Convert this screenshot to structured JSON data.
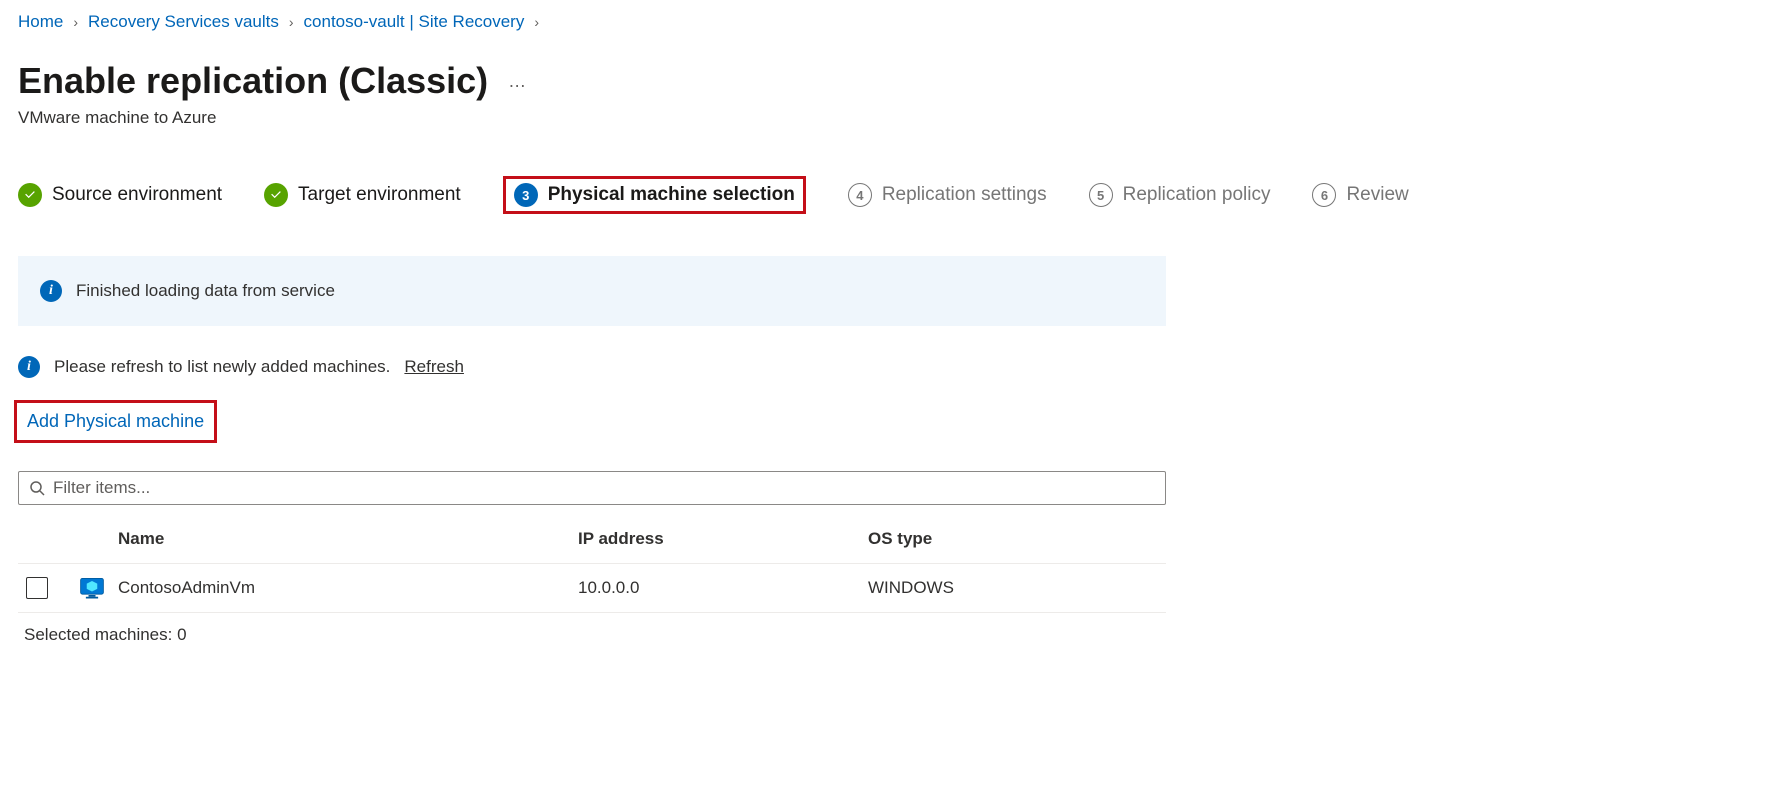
{
  "breadcrumb": [
    {
      "label": "Home"
    },
    {
      "label": "Recovery Services vaults"
    },
    {
      "label": "contoso-vault | Site Recovery"
    }
  ],
  "page": {
    "title": "Enable replication (Classic)",
    "subtitle": "VMware machine to Azure"
  },
  "steps": [
    {
      "label": "Source environment",
      "state": "done",
      "num": "1"
    },
    {
      "label": "Target environment",
      "state": "done",
      "num": "2"
    },
    {
      "label": "Physical machine selection",
      "state": "current",
      "num": "3"
    },
    {
      "label": "Replication settings",
      "state": "future",
      "num": "4"
    },
    {
      "label": "Replication policy",
      "state": "future",
      "num": "5"
    },
    {
      "label": "Review",
      "state": "future",
      "num": "6"
    }
  ],
  "banner": {
    "message": "Finished loading data from service"
  },
  "refresh": {
    "text": "Please refresh to list newly added machines.",
    "link": "Refresh"
  },
  "actions": {
    "add_physical_machine": "Add Physical machine"
  },
  "filter": {
    "placeholder": "Filter items..."
  },
  "table": {
    "headers": {
      "name": "Name",
      "ip": "IP address",
      "os": "OS type"
    },
    "rows": [
      {
        "name": "ContosoAdminVm",
        "ip": "10.0.0.0",
        "os": "WINDOWS"
      }
    ]
  },
  "selected": {
    "label": "Selected machines:",
    "count": "0"
  }
}
